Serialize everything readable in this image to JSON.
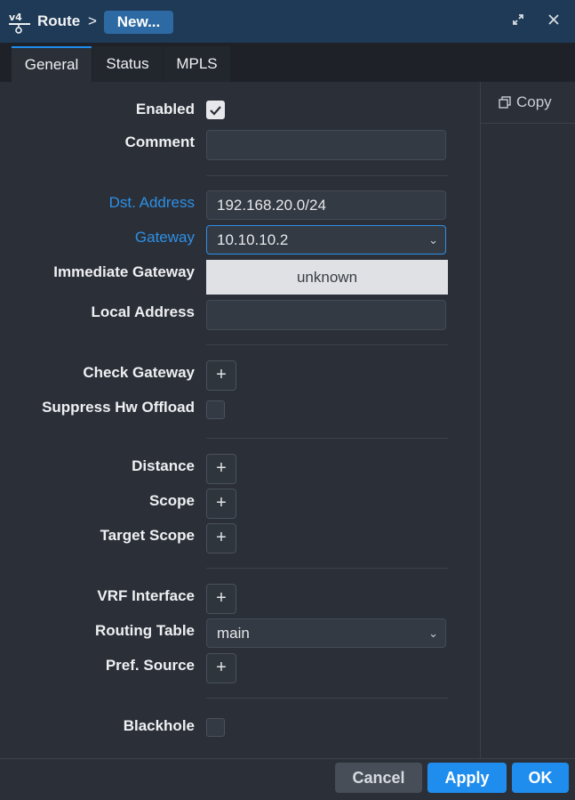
{
  "window": {
    "title": "Route",
    "breadcrumb_separator": ">",
    "record": "New...",
    "icons": [
      "v4-route-icon",
      "restore-icon",
      "close-icon"
    ]
  },
  "tabs": [
    {
      "label": "General",
      "active": true
    },
    {
      "label": "Status",
      "active": false
    },
    {
      "label": "MPLS",
      "active": false
    }
  ],
  "side": {
    "copy_label": "Copy"
  },
  "form": {
    "enabled": {
      "label": "Enabled",
      "checked": true
    },
    "comment": {
      "label": "Comment",
      "value": ""
    },
    "dst_address": {
      "label": "Dst. Address",
      "value": "192.168.20.0/24"
    },
    "gateway": {
      "label": "Gateway",
      "value": "10.10.10.2"
    },
    "immediate_gateway": {
      "label": "Immediate Gateway",
      "value": "unknown"
    },
    "local_address": {
      "label": "Local Address",
      "value": ""
    },
    "check_gateway": {
      "label": "Check Gateway"
    },
    "suppress_hw_offload": {
      "label": "Suppress Hw Offload",
      "checked": false
    },
    "distance": {
      "label": "Distance"
    },
    "scope": {
      "label": "Scope"
    },
    "target_scope": {
      "label": "Target Scope"
    },
    "vrf_interface": {
      "label": "VRF Interface"
    },
    "routing_table": {
      "label": "Routing Table",
      "value": "main"
    },
    "pref_source": {
      "label": "Pref. Source"
    },
    "blackhole": {
      "label": "Blackhole",
      "checked": false
    }
  },
  "footer": {
    "cancel": "Cancel",
    "apply": "Apply",
    "ok": "OK"
  },
  "colors": {
    "accent": "#1f8ded",
    "titlebar": "#1f3a56",
    "background": "#2b3038",
    "label_highlight": "#2d8fe6"
  }
}
